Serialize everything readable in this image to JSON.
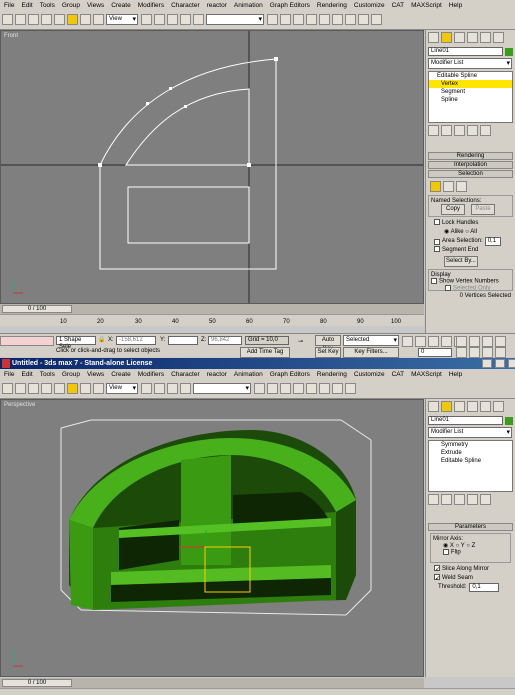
{
  "menu": [
    "File",
    "Edit",
    "Tools",
    "Group",
    "Views",
    "Create",
    "Modifiers",
    "Character",
    "reactor",
    "Animation",
    "Graph Editors",
    "Rendering",
    "Customize",
    "CAT",
    "MAXScript",
    "Help"
  ],
  "toolbar": {
    "view_select": "View",
    "view_select2": "View"
  },
  "top": {
    "viewport_label": "Front",
    "object_name": "Line01",
    "modifier_list": "Modifier List",
    "stack": [
      {
        "label": "Editable Spline"
      },
      {
        "label": "Vertex"
      },
      {
        "label": "Segment"
      },
      {
        "label": "Spline"
      }
    ],
    "rollouts": {
      "rendering": "Rendering",
      "interpolation": "Interpolation",
      "selection": "Selection"
    },
    "named_selections": "Named Selections:",
    "copy": "Copy",
    "paste": "Paste",
    "lock_handles": "Lock Handles",
    "alike": "Alike",
    "all": "All",
    "area_selection": "Area Selection:",
    "area_value": "0,1",
    "segment_end": "Segment End",
    "select_by": "Select By...",
    "display": "Display",
    "show_vertex_numbers": "Show Vertex Numbers",
    "selected_only": "Selected Only",
    "vertices_selected": "0 Vertices Selected",
    "time": "0 / 100",
    "ruler": [
      "10",
      "20",
      "30",
      "40",
      "50",
      "60",
      "70",
      "80",
      "90",
      "100"
    ],
    "status_shape": "1 Shape Sele",
    "x_label": "X:",
    "x_value": "-158,612",
    "y_label": "Y:",
    "y_value": "",
    "z_label": "Z:",
    "z_value": "96,842",
    "grid": "Grid = 10,0",
    "autokey": "Auto Key",
    "autokey_value": "Selected",
    "setkey": "Set Key",
    "key_filters": "Key Filters...",
    "prompt": "Click or click-and-drag to select objects",
    "add_time_tag": "Add Time Tag",
    "frame": "0"
  },
  "bottom": {
    "title": "Untitled - 3ds max 7 - Stand-alone License",
    "viewport_label": "Perspective",
    "object_name": "Line01",
    "modifier_list": "Modifier List",
    "stack": [
      {
        "label": "Symmetry"
      },
      {
        "label": "Extrude"
      },
      {
        "label": "Editable Spline"
      }
    ],
    "parameters": "Parameters",
    "mirror_axis": "Mirror Axis:",
    "axes": [
      "X",
      "Y",
      "Z"
    ],
    "flip": "Flip",
    "slice": "Slice Along Mirror",
    "weld": "Weld Seam",
    "threshold": "Threshold:",
    "threshold_value": "0,1",
    "time": "0 / 100"
  },
  "colors": {
    "model": "#3a9b12",
    "highlight": "#ffe600",
    "viewport": "#7f7f7f"
  }
}
